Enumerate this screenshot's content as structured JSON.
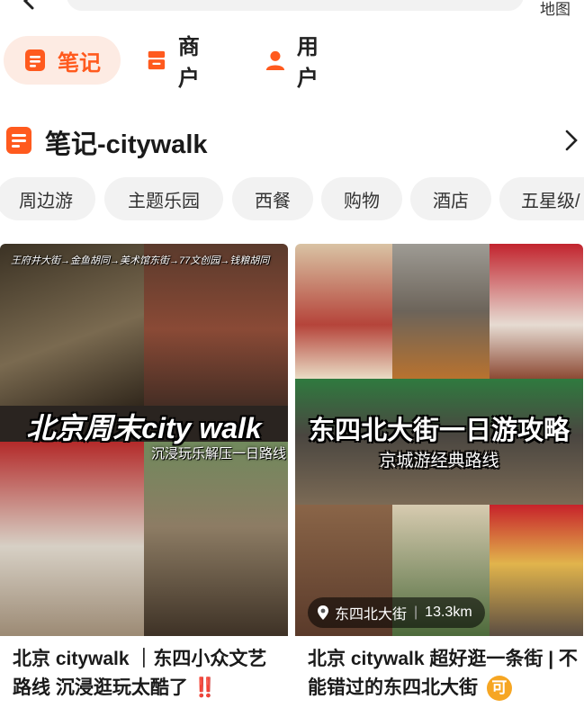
{
  "topbar": {
    "map_label": "地图"
  },
  "tabs": [
    {
      "label": "笔记",
      "icon": "note-icon",
      "active": true
    },
    {
      "label": "商户",
      "icon": "shop-icon",
      "active": false
    },
    {
      "label": "用户",
      "icon": "user-icon",
      "active": false
    }
  ],
  "section": {
    "title": "笔记-citywalk",
    "icon": "note-icon"
  },
  "chips": [
    "周边游",
    "主题乐园",
    "西餐",
    "购物",
    "酒店",
    "五星级/"
  ],
  "colors": {
    "accent": "#ff5a1e",
    "accent_bg": "#fdebe3",
    "chip_bg": "#f2f2f2"
  },
  "cards": [
    {
      "route_caption": "王府井大街→金鱼胡同→美术馆东街→77文创园→钱粮胡同",
      "overlay_title": "北京周末city walk",
      "overlay_subtitle": "沉浸玩乐解压一日路线",
      "title": "北京 citywalk ｜东四小众文艺路线 沉浸逛玩太酷了",
      "badge": "‼️"
    },
    {
      "overlay_title": "东四北大街一日游攻略",
      "overlay_subtitle": "京城游经典路线",
      "location": "东四北大街",
      "distance": "13.3km",
      "title": "北京 citywalk 超好逛一条街 | 不能错过的东四北大街",
      "badge": "可"
    }
  ]
}
